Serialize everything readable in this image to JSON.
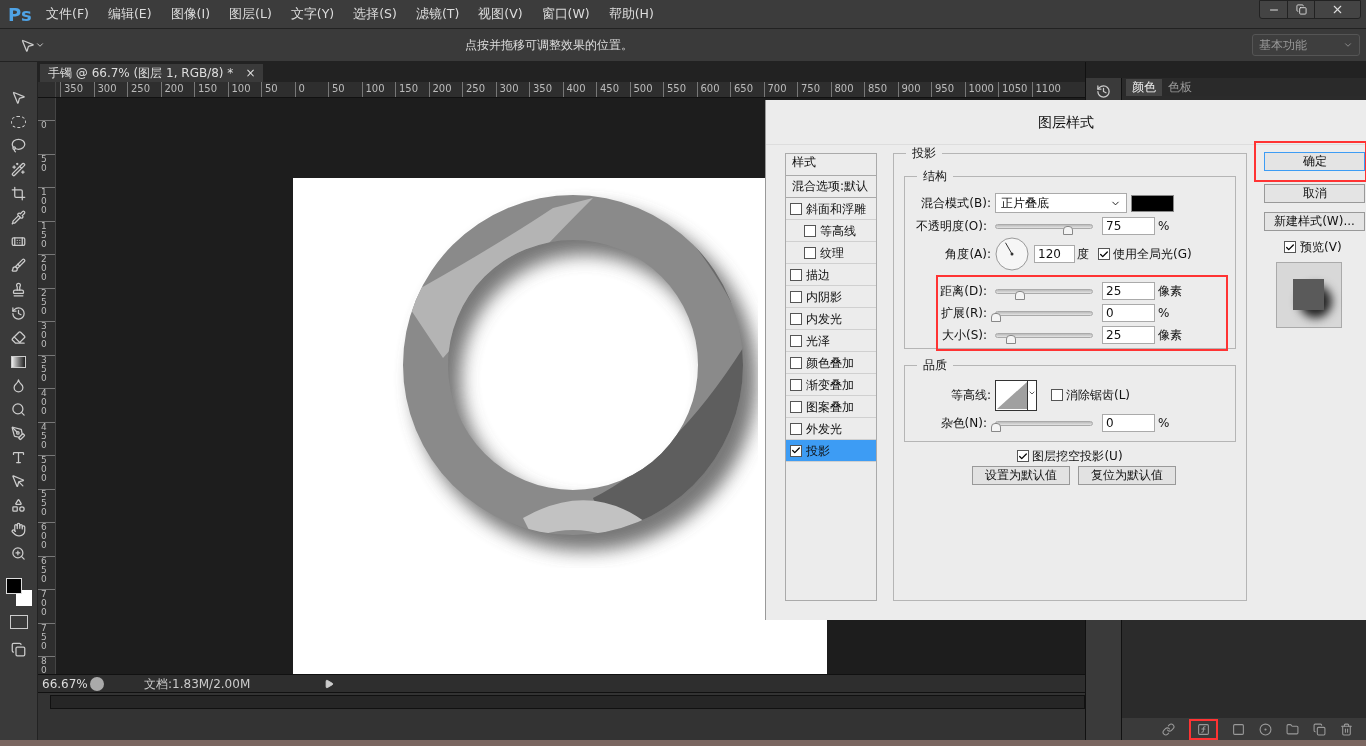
{
  "app": {
    "logo": "Ps",
    "menu": [
      "文件(F)",
      "编辑(E)",
      "图像(I)",
      "图层(L)",
      "文字(Y)",
      "选择(S)",
      "滤镜(T)",
      "视图(V)",
      "窗口(W)",
      "帮助(H)"
    ]
  },
  "options_bar": {
    "hint": "点按并拖移可调整效果的位置。",
    "workspace": "基本功能"
  },
  "document_tab": {
    "title": "手镯 @ 66.7% (图层 1, RGB/8) *",
    "close": "×"
  },
  "rulers": {
    "horizontal": [
      "350",
      "300",
      "250",
      "200",
      "150",
      "100",
      "50",
      "0",
      "50",
      "100",
      "150",
      "200",
      "250",
      "300",
      "350",
      "400",
      "450",
      "500",
      "550",
      "600",
      "650",
      "700",
      "750",
      "800",
      "850",
      "900",
      "950",
      "1000",
      "1050",
      "1100"
    ],
    "vertical": [
      "0",
      "50",
      "100",
      "150",
      "200",
      "250",
      "300",
      "350",
      "400",
      "450",
      "500",
      "550",
      "600",
      "650",
      "700",
      "750",
      "80"
    ]
  },
  "status_bar": {
    "zoom": "66.67%",
    "doc_info": "文档:1.83M/2.00M"
  },
  "right_panel": {
    "tabs": [
      {
        "label": "颜色",
        "selected": true
      },
      {
        "label": "色板",
        "selected": false
      }
    ]
  },
  "layers_footer": {
    "fx_highlighted": true
  },
  "dialog": {
    "title": "图层样式",
    "styles_header": "样式",
    "blending_options": "混合选项:默认",
    "styles": [
      {
        "label": "斜面和浮雕",
        "checked": false,
        "selected": false,
        "children": [
          {
            "label": "等高线",
            "checked": false,
            "selected": false
          },
          {
            "label": "纹理",
            "checked": false,
            "selected": false
          }
        ]
      },
      {
        "label": "描边",
        "checked": false,
        "selected": false
      },
      {
        "label": "内阴影",
        "checked": false,
        "selected": false
      },
      {
        "label": "内发光",
        "checked": false,
        "selected": false
      },
      {
        "label": "光泽",
        "checked": false,
        "selected": false
      },
      {
        "label": "颜色叠加",
        "checked": false,
        "selected": false
      },
      {
        "label": "渐变叠加",
        "checked": false,
        "selected": false
      },
      {
        "label": "图案叠加",
        "checked": false,
        "selected": false
      },
      {
        "label": "外发光",
        "checked": false,
        "selected": false
      },
      {
        "label": "投影",
        "checked": true,
        "selected": true
      }
    ],
    "section_title": "投影",
    "structure": {
      "title": "结构",
      "blend_mode": {
        "label": "混合模式(B):",
        "value": "正片叠底",
        "color": "#000000"
      },
      "opacity": {
        "label": "不透明度(O):",
        "level": 0.75,
        "value": "75",
        "unit": "%"
      },
      "angle": {
        "label": "角度(A):",
        "value": "120",
        "unit": "度",
        "global_light": {
          "label": "使用全局光(G)",
          "checked": true
        }
      },
      "highlighted": true,
      "sliders": [
        {
          "label": "距离(D):",
          "level": 0.25,
          "value": "25",
          "unit": "像素"
        },
        {
          "label": "扩展(R):",
          "level": 0,
          "value": "0",
          "unit": "%"
        },
        {
          "label": "大小(S):",
          "level": 0.16,
          "value": "25",
          "unit": "像素"
        }
      ]
    },
    "quality": {
      "title": "品质",
      "contour": {
        "label": "等高线:"
      },
      "anti_alias": {
        "label": "消除锯齿(L)",
        "checked": false
      },
      "noise": {
        "label": "杂色(N):",
        "level": 0,
        "value": "0",
        "unit": "%"
      }
    },
    "knockout": {
      "label": "图层挖空投影(U)",
      "checked": true
    },
    "default_buttons": [
      "设置为默认值",
      "复位为默认值"
    ],
    "side_buttons": [
      {
        "label": "确定",
        "default": true,
        "highlighted": true
      },
      {
        "label": "取消",
        "default": false,
        "highlighted": false
      },
      {
        "label": "新建样式(W)...",
        "default": false,
        "highlighted": false
      }
    ],
    "preview": {
      "label": "预览(V)",
      "checked": true
    }
  }
}
